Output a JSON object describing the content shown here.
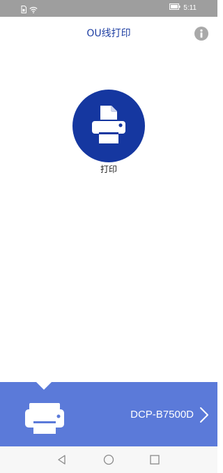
{
  "status_bar": {
    "time": "5:11",
    "icons": [
      "sim-card-icon",
      "wifi-icon",
      "battery-icon"
    ]
  },
  "header": {
    "title": "OU线打印",
    "info_icon": "info-icon"
  },
  "main": {
    "print_tile": {
      "label": "打印",
      "icon": "printer-icon"
    }
  },
  "device_bar": {
    "device_name": "DCP-B7500D",
    "icon": "printer-icon",
    "chevron": "chevron-right-icon"
  },
  "nav_bar": {
    "buttons": [
      "back-icon",
      "home-icon",
      "recents-icon"
    ]
  },
  "colors": {
    "status_bar": "#9e9e9e",
    "title": "#1f3fa3",
    "print_circle": "#1537a0",
    "device_bar": "#5b7ad9",
    "nav_bar": "#f7f7f7"
  }
}
